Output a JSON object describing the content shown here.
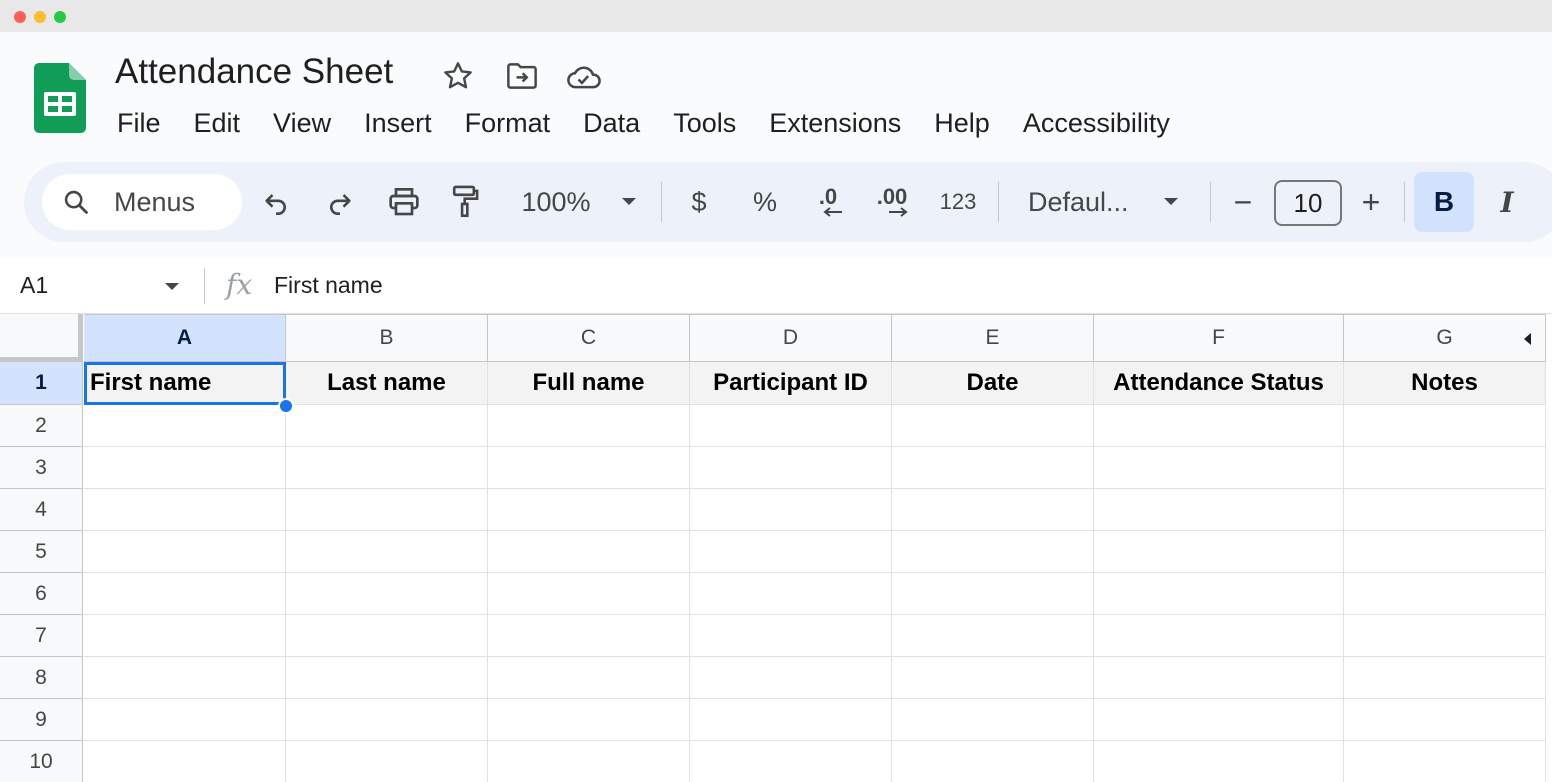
{
  "window": {
    "controls": [
      "close",
      "minimize",
      "zoom"
    ]
  },
  "app": {
    "title": "Attendance Sheet",
    "logo_icon": "sheets-logo-icon"
  },
  "header_icons": [
    {
      "name": "star-icon"
    },
    {
      "name": "move-to-folder-icon"
    },
    {
      "name": "cloud-saved-icon"
    }
  ],
  "menu": {
    "items": [
      "File",
      "Edit",
      "View",
      "Insert",
      "Format",
      "Data",
      "Tools",
      "Extensions",
      "Help",
      "Accessibility"
    ]
  },
  "toolbar": {
    "search_label": "Menus",
    "zoom": "100%",
    "currency": "$",
    "percent": "%",
    "decrease_decimal": ".0",
    "increase_decimal": ".00",
    "number_format": "123",
    "font": "Defaul...",
    "minus": "−",
    "font_size": "10",
    "plus": "+",
    "bold": "B",
    "italic": "I"
  },
  "formula_bar": {
    "cell_ref": "A1",
    "fx": "fx",
    "value": "First name"
  },
  "sheet": {
    "columns": [
      "A",
      "B",
      "C",
      "D",
      "E",
      "F",
      "G"
    ],
    "rows": [
      "1",
      "2",
      "3",
      "4",
      "5",
      "6",
      "7",
      "8",
      "9",
      "10"
    ],
    "header_row": [
      "First name",
      "Last name",
      "Full name",
      "Participant ID",
      "Date",
      "Attendance Status",
      "Notes"
    ],
    "selected_cell": "A1"
  },
  "colors": {
    "accent": "#1a73e8",
    "selection_bg": "#d3e3fd",
    "toolbar_bg": "#edf2fa",
    "logo_green": "#0f9d58"
  }
}
